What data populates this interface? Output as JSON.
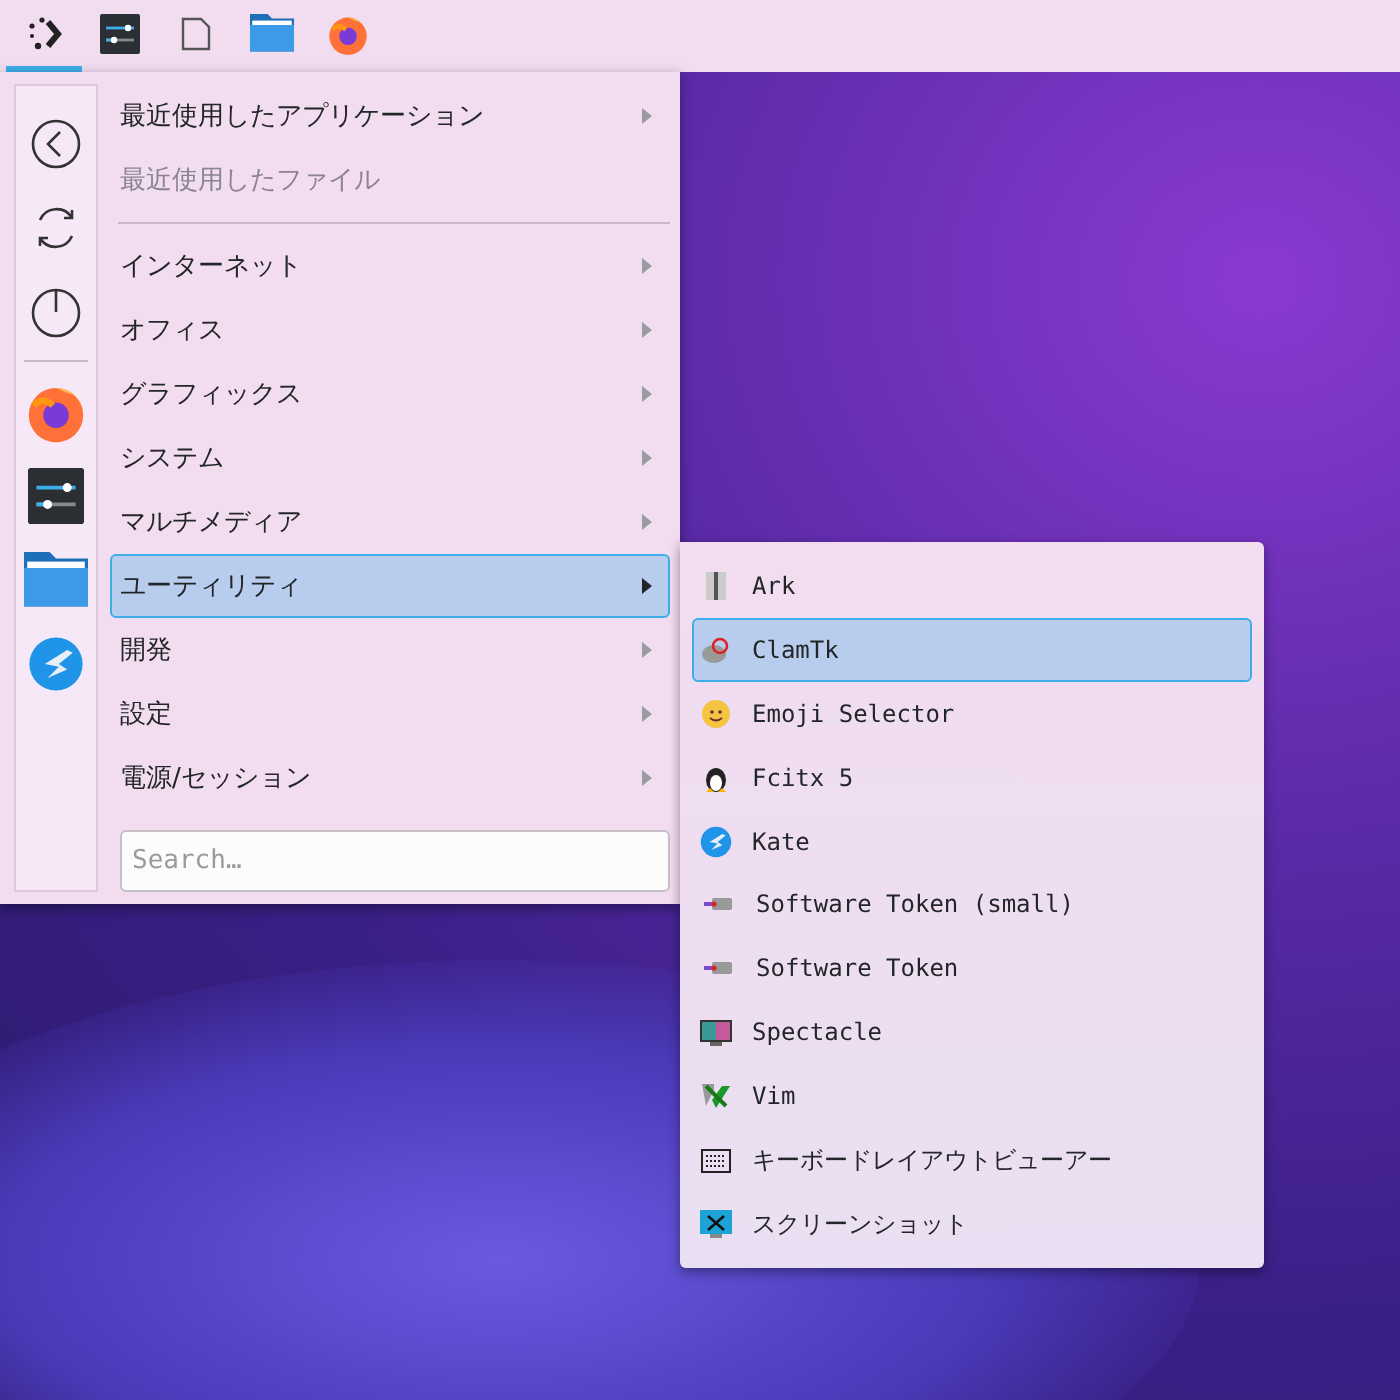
{
  "panel": {
    "items": [
      {
        "selected": true
      },
      {
        "selected": false
      },
      {
        "selected": false
      },
      {
        "selected": false
      },
      {
        "selected": false
      }
    ]
  },
  "menu": {
    "items": [
      {
        "kind": "entry",
        "label": "最近使用したアプリケーション",
        "disabled": false,
        "submenu": true,
        "selected": false
      },
      {
        "kind": "entry",
        "label": "最近使用したファイル",
        "disabled": true,
        "submenu": false,
        "selected": false
      },
      {
        "kind": "separator"
      },
      {
        "kind": "entry",
        "label": "インターネット",
        "disabled": false,
        "submenu": true,
        "selected": false
      },
      {
        "kind": "entry",
        "label": "オフィス",
        "disabled": false,
        "submenu": true,
        "selected": false
      },
      {
        "kind": "entry",
        "label": "グラフィックス",
        "disabled": false,
        "submenu": true,
        "selected": false
      },
      {
        "kind": "entry",
        "label": "システム",
        "disabled": false,
        "submenu": true,
        "selected": false
      },
      {
        "kind": "entry",
        "label": "マルチメディア",
        "disabled": false,
        "submenu": true,
        "selected": false
      },
      {
        "kind": "entry",
        "label": "ユーティリティ",
        "disabled": false,
        "submenu": true,
        "selected": true
      },
      {
        "kind": "entry",
        "label": "開発",
        "disabled": false,
        "submenu": true,
        "selected": false
      },
      {
        "kind": "entry",
        "label": "設定",
        "disabled": false,
        "submenu": true,
        "selected": false
      },
      {
        "kind": "entry",
        "label": "電源/セッション",
        "disabled": false,
        "submenu": true,
        "selected": false
      }
    ],
    "search": {
      "placeholder": "Search…"
    }
  },
  "submenu": {
    "items": [
      {
        "label": "Ark",
        "selected": false
      },
      {
        "label": "ClamTk",
        "selected": true
      },
      {
        "label": "Emoji Selector",
        "selected": false
      },
      {
        "label": "Fcitx 5",
        "selected": false
      },
      {
        "label": "Kate",
        "selected": false
      },
      {
        "label": "Software Token (small)",
        "selected": false
      },
      {
        "label": "Software Token",
        "selected": false
      },
      {
        "label": "Spectacle",
        "selected": false
      },
      {
        "label": "Vim",
        "selected": false
      },
      {
        "label": "キーボードレイアウトビューアー",
        "selected": false
      },
      {
        "label": "スクリーンショット",
        "selected": false
      }
    ]
  }
}
